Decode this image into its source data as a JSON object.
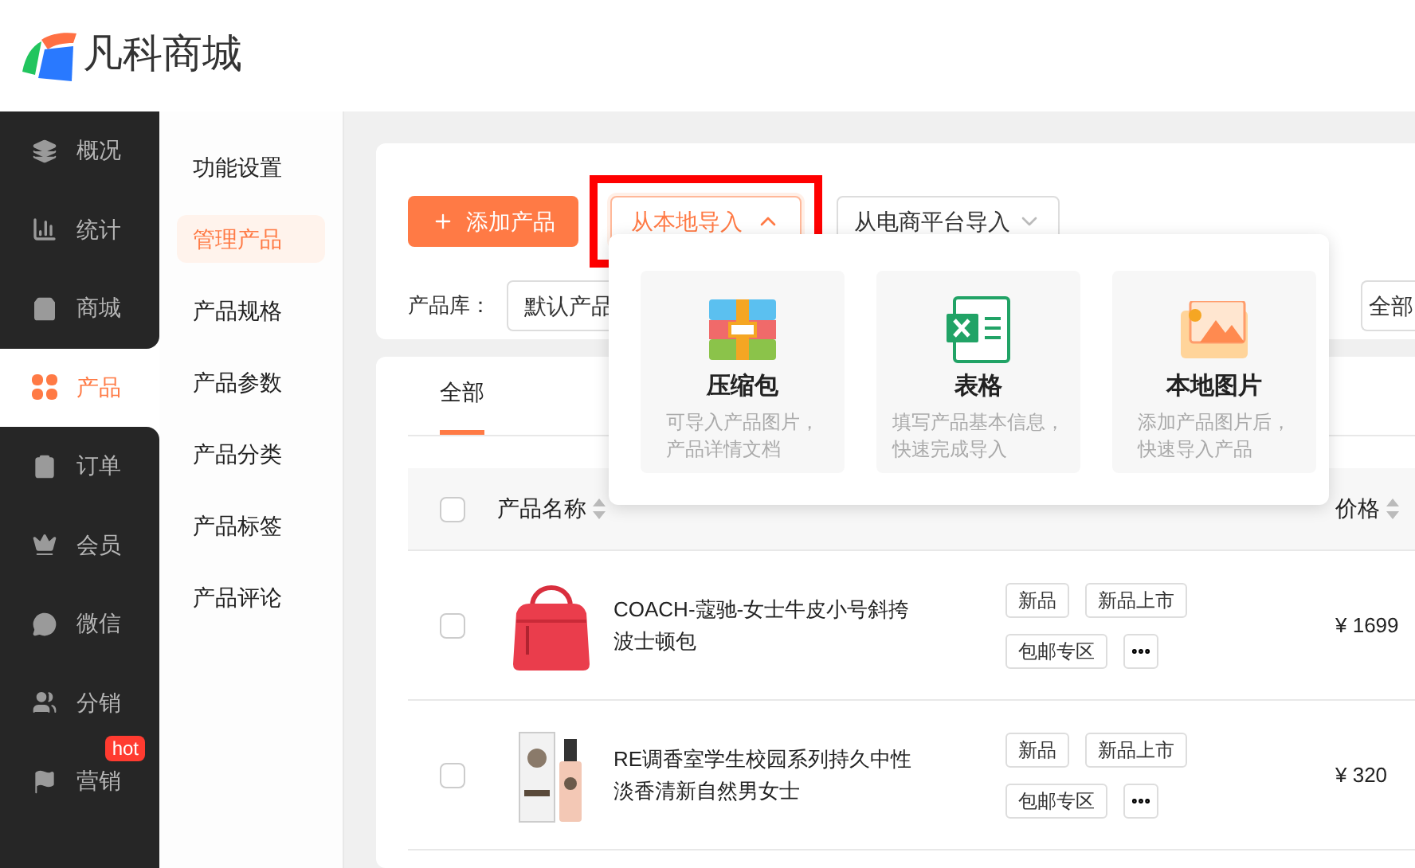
{
  "logo": {
    "text": "凡科商城"
  },
  "nav": [
    {
      "label": "概况",
      "selected": false
    },
    {
      "label": "统计",
      "selected": false
    },
    {
      "label": "商城",
      "selected": false
    },
    {
      "label": "产品",
      "selected": true
    },
    {
      "label": "订单",
      "selected": false
    },
    {
      "label": "会员",
      "selected": false
    },
    {
      "label": "微信",
      "selected": false
    },
    {
      "label": "分销",
      "selected": false
    },
    {
      "label": "营销",
      "selected": false,
      "badge": "hot"
    }
  ],
  "subnav": [
    {
      "label": "功能设置",
      "selected": false
    },
    {
      "label": "管理产品",
      "selected": true
    },
    {
      "label": "产品规格",
      "selected": false
    },
    {
      "label": "产品参数",
      "selected": false
    },
    {
      "label": "产品分类",
      "selected": false
    },
    {
      "label": "产品标签",
      "selected": false
    },
    {
      "label": "产品评论",
      "selected": false
    }
  ],
  "toolbar": {
    "add_button": "添加产品",
    "local_import": {
      "label": "从本地导入",
      "expanded": true
    },
    "platform_import": "从电商平台导入"
  },
  "filter": {
    "label": "产品库：",
    "library": "默认产品",
    "status": "全部"
  },
  "import_menu": [
    {
      "kind": "archive",
      "title": "压缩包",
      "description": [
        "可导入产品图片，",
        "产品详情文档"
      ]
    },
    {
      "kind": "sheet",
      "title": "表格",
      "description": [
        "填写产品基本信息，",
        "快速完成导入"
      ]
    },
    {
      "title": "本地图片",
      "description": [
        "添加产品图片后，",
        "快速导入产品"
      ]
    }
  ],
  "tabs": [
    {
      "label": "全部",
      "selected": true
    }
  ],
  "table": {
    "select_all_checked": false,
    "columns": [
      {
        "label": "产品名称"
      },
      {
        "label": "价格"
      }
    ],
    "rows": [
      {
        "kind": "bag",
        "checked": false,
        "name": "COACH-蔻驰-女士牛皮小号斜挎波士顿包",
        "tags": [
          "新品",
          "新品上市",
          "包邮专区"
        ],
        "price": "¥ 1699"
      },
      {
        "kind": "bottle",
        "checked": false,
        "name": "RE调香室学生校园系列持久中性淡香清新自然男女士",
        "tags": [
          "新品",
          "新品上市",
          "包邮专区"
        ],
        "price": "¥ 320"
      }
    ]
  }
}
